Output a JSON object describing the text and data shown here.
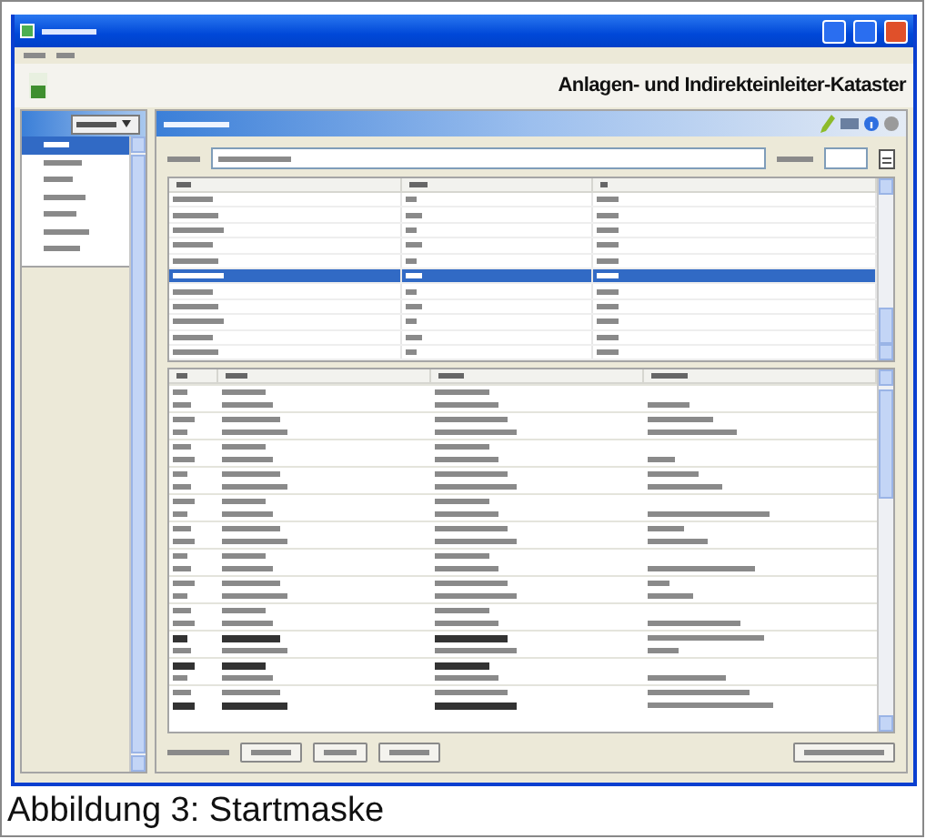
{
  "window": {
    "heading": "Anlagen- und Indirekteinleiter-Kataster"
  },
  "sidebar": {
    "items": [
      {
        "selected": true
      },
      {
        "selected": false
      },
      {
        "selected": false
      },
      {
        "selected": false
      },
      {
        "selected": false
      },
      {
        "selected": false
      },
      {
        "selected": false
      }
    ]
  },
  "upper_table": {
    "rows": [
      {
        "selected": false
      },
      {
        "selected": false
      },
      {
        "selected": false
      },
      {
        "selected": false
      },
      {
        "selected": false
      },
      {
        "selected": true
      },
      {
        "selected": false
      },
      {
        "selected": false
      },
      {
        "selected": false
      },
      {
        "selected": false
      },
      {
        "selected": false
      }
    ]
  },
  "lower_table": {
    "rows": [
      {
        "kind": "plain"
      },
      {
        "kind": "plain"
      },
      {
        "kind": "plain"
      },
      {
        "kind": "plain"
      },
      {
        "kind": "plain"
      },
      {
        "kind": "plain"
      },
      {
        "kind": "plain"
      },
      {
        "kind": "plain"
      },
      {
        "kind": "plain"
      },
      {
        "kind": "plain"
      },
      {
        "kind": "plain"
      },
      {
        "kind": "plain"
      },
      {
        "kind": "plain"
      },
      {
        "kind": "plain"
      },
      {
        "kind": "plain"
      },
      {
        "kind": "plain"
      },
      {
        "kind": "plain"
      },
      {
        "kind": "plain"
      },
      {
        "kind": "struck"
      },
      {
        "kind": "plain"
      },
      {
        "kind": "struck"
      },
      {
        "kind": "plain"
      },
      {
        "kind": "plain"
      },
      {
        "kind": "struck"
      }
    ]
  },
  "caption": "Abbildung 3: Startmaske"
}
